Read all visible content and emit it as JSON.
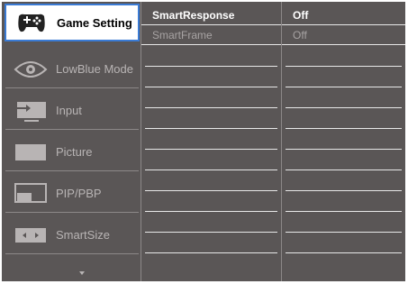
{
  "menu": {
    "items": [
      {
        "label": "Game Setting",
        "icon": "gamepad-icon",
        "active": true
      },
      {
        "label": "LowBlue Mode",
        "icon": "eye-icon"
      },
      {
        "label": "Input",
        "icon": "input-icon"
      },
      {
        "label": "Picture",
        "icon": "picture-icon"
      },
      {
        "label": "PIP/PBP",
        "icon": "pip-icon"
      },
      {
        "label": "SmartSize",
        "icon": "smartsize-icon"
      }
    ]
  },
  "submenu": {
    "items": [
      {
        "label": "SmartResponse"
      },
      {
        "label": "SmartFrame"
      }
    ]
  },
  "values": {
    "items": [
      {
        "label": "Off"
      },
      {
        "label": "Off"
      }
    ]
  },
  "colors": {
    "panel": "#5a5656",
    "highlight": "#ffffff",
    "active_border": "#3a7bd5"
  }
}
